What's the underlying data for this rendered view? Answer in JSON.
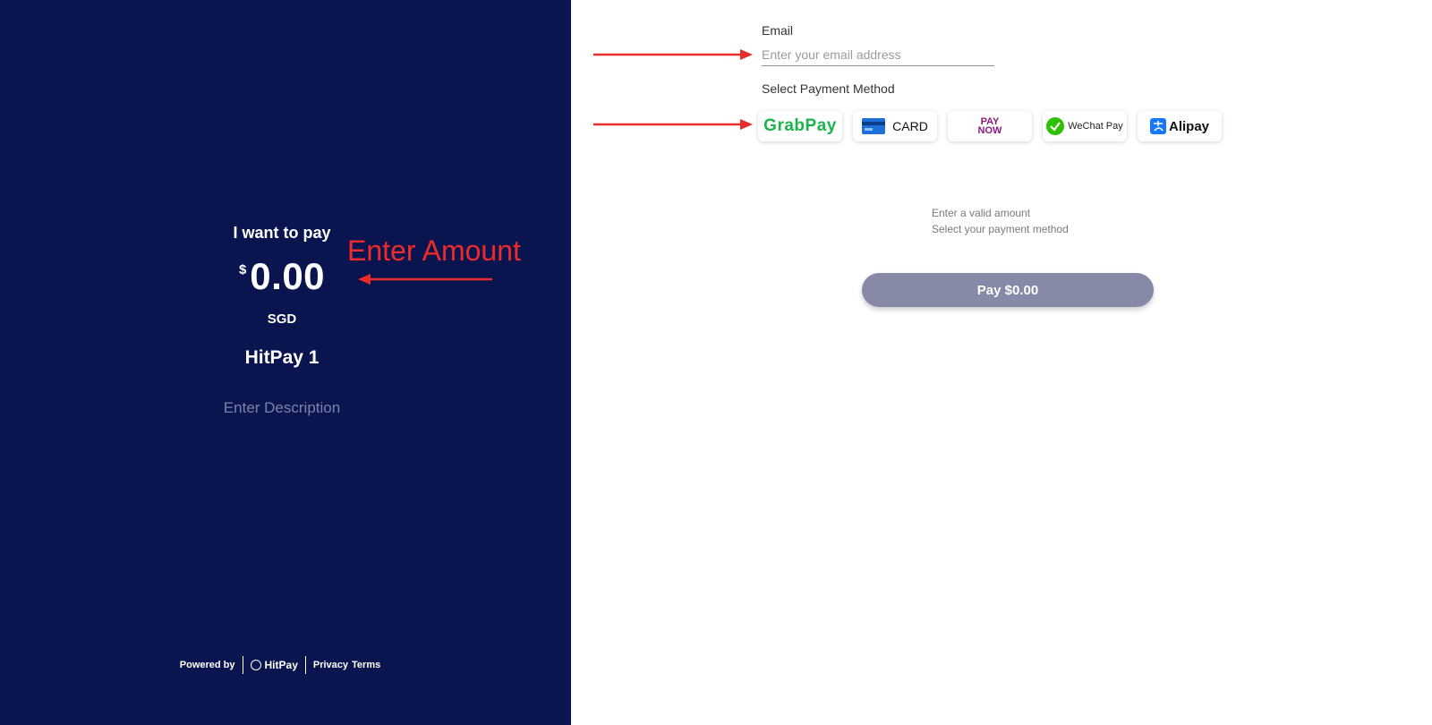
{
  "left": {
    "prompt": "I want to pay",
    "currency_symbol": "$",
    "amount": "0.00",
    "currency_code": "SGD",
    "merchant_name": "HitPay 1",
    "description_placeholder": "Enter Description",
    "annotation": "Enter Amount",
    "footer": {
      "powered_by": "Powered by",
      "brand": "HitPay",
      "privacy": "Privacy",
      "terms": "Terms"
    }
  },
  "form": {
    "email_label": "Email",
    "email_placeholder": "Enter your email address",
    "email_value": "",
    "method_label": "Select Payment Method",
    "methods": [
      {
        "label": "GrabPay",
        "icon": "grabpay-logo"
      },
      {
        "label": "CARD",
        "icon": "credit-card-icon"
      },
      {
        "label_top": "PAY",
        "label_bottom": "NOW",
        "icon": "paynow-logo"
      },
      {
        "label": "WeChat Pay",
        "icon": "wechat-icon"
      },
      {
        "label": "Alipay",
        "icon": "alipay-icon"
      }
    ],
    "hint_amount": "Enter a valid amount",
    "hint_method": "Select your payment method",
    "pay_button": "Pay $0.00"
  },
  "colors": {
    "panel_bg": "#0a1550",
    "annotation": "#ec2b2b",
    "pay_button_bg": "#868aa7",
    "grabpay": "#1bb34e",
    "paynow": "#8a1a7c",
    "wechat": "#2dc100",
    "alipay": "#1677ff"
  }
}
